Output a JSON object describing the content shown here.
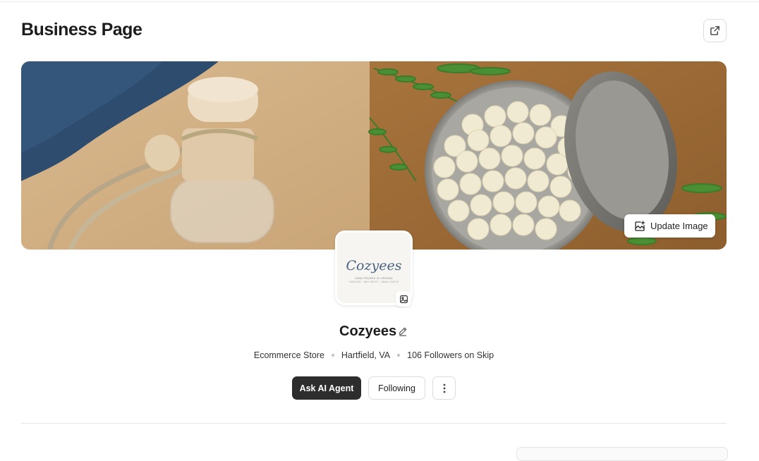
{
  "header": {
    "title": "Business Page"
  },
  "banner": {
    "update_label": "Update Image"
  },
  "logo": {
    "wordmark": "Cozyees",
    "tagline1": "HAND-POURED IN VIRGINIA",
    "tagline2": "CANDLES · WAX MELTS · SMALL BATCH"
  },
  "business": {
    "name": "Cozyees",
    "category": "Ecommerce Store",
    "location": "Hartfield, VA",
    "followers": "106 Followers on Skip"
  },
  "actions": {
    "ask_label": "Ask AI Agent",
    "follow_label": "Following"
  },
  "colors": {
    "primary_button": "#2d2d2d",
    "logo_text": "#4a6380",
    "border": "#dcdcdc"
  }
}
